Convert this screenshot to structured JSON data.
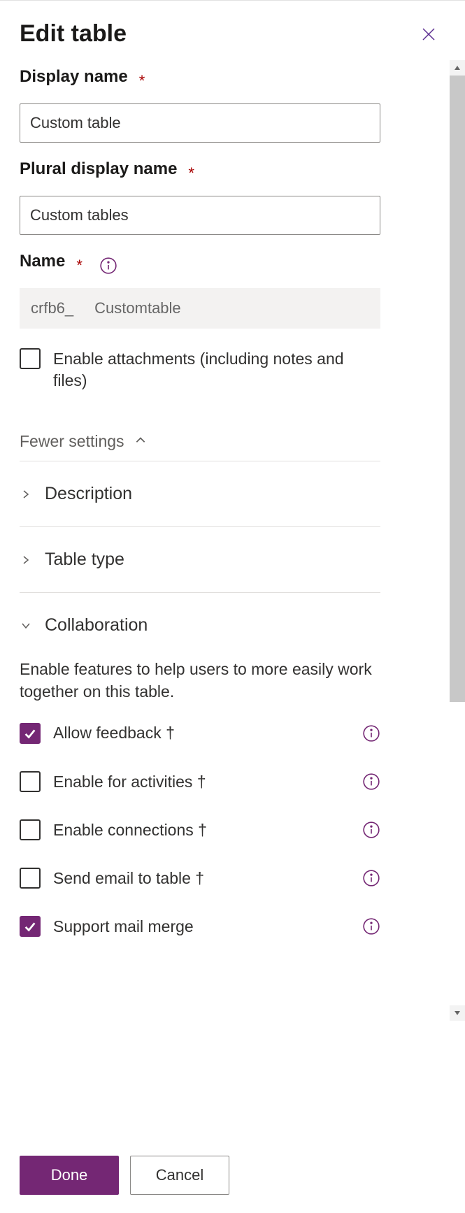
{
  "header": {
    "title": "Edit table"
  },
  "fields": {
    "display_name": {
      "label": "Display name",
      "value": "Custom table"
    },
    "plural_display_name": {
      "label": "Plural display name",
      "value": "Custom tables"
    },
    "name": {
      "label": "Name",
      "prefix": "crfb6_",
      "value": "Customtable"
    },
    "enable_attachments": {
      "label": "Enable attachments (including notes and files)"
    }
  },
  "settings_toggle": {
    "label": "Fewer settings"
  },
  "accordions": {
    "description": {
      "title": "Description"
    },
    "table_type": {
      "title": "Table type"
    },
    "collaboration": {
      "title": "Collaboration",
      "description": "Enable features to help users to more easily work together on this table.",
      "options": {
        "allow_feedback": "Allow feedback †",
        "enable_activities": "Enable for activities †",
        "enable_connections": "Enable connections †",
        "send_email": "Send email to table †",
        "mail_merge": "Support mail merge"
      }
    }
  },
  "footer": {
    "done": "Done",
    "cancel": "Cancel"
  }
}
